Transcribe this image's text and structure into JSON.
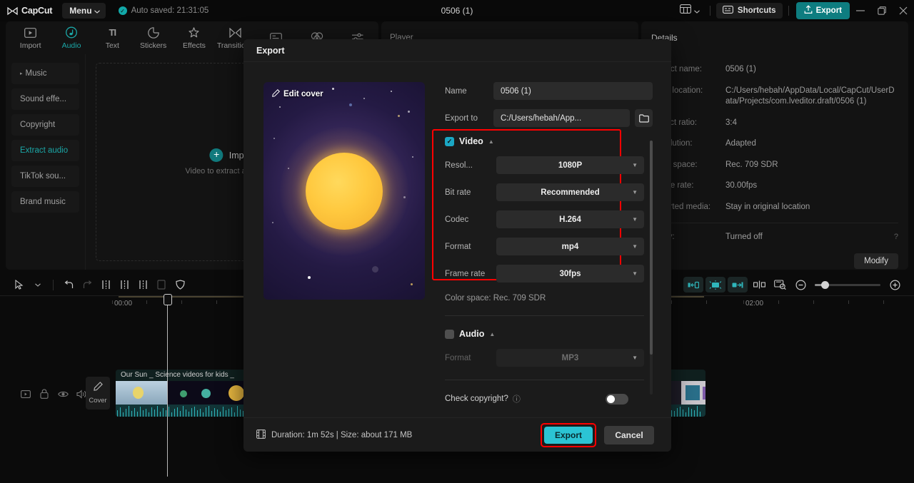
{
  "titlebar": {
    "app_name": "CapCut",
    "menu_label": "Menu",
    "autosave_text": "Auto saved: 21:31:05",
    "project_title": "0506 (1)",
    "shortcuts_label": "Shortcuts",
    "export_label": "Export",
    "minimize_icon": "minimize-icon",
    "maximize_icon": "maximize-icon",
    "close_icon": "close-icon",
    "layout_icon": "layout-icon"
  },
  "tooltabs": [
    {
      "label": "Import",
      "icon": "import-icon",
      "active": false
    },
    {
      "label": "Audio",
      "icon": "audio-note-icon",
      "active": true
    },
    {
      "label": "Text",
      "icon": "text-icon",
      "active": false
    },
    {
      "label": "Stickers",
      "icon": "sticker-icon",
      "active": false
    },
    {
      "label": "Effects",
      "icon": "effects-sparkle-icon",
      "active": false
    },
    {
      "label": "Transitions",
      "icon": "transitions-icon",
      "active": false
    },
    {
      "label": "",
      "icon": "captions-icon",
      "active": false
    },
    {
      "label": "",
      "icon": "filters-icon",
      "active": false
    },
    {
      "label": "",
      "icon": "adjustment-icon",
      "active": false
    }
  ],
  "media_sidebar": [
    {
      "label": "Music",
      "caret": "▸",
      "active": false
    },
    {
      "label": "Sound effe...",
      "caret": "",
      "active": false
    },
    {
      "label": "Copyright",
      "caret": "",
      "active": false
    },
    {
      "label": "Extract audio",
      "caret": "",
      "active": true
    },
    {
      "label": "TikTok sou...",
      "caret": "",
      "active": false
    },
    {
      "label": "Brand music",
      "caret": "",
      "active": false
    }
  ],
  "media_body": {
    "import_label": "Import",
    "import_sub": "Video to extract audio from",
    "plus_icon": "plus-circle-icon"
  },
  "panels": {
    "player_title": "Player",
    "details_title": "Details"
  },
  "details": [
    {
      "key": "Project name:",
      "value": "0506 (1)"
    },
    {
      "key": "Save location:",
      "value": "C:/Users/hebah/AppData/Local/CapCut/UserData/Projects/com.lveditor.draft/0506 (1)"
    },
    {
      "key": "Aspect ratio:",
      "value": "3:4"
    },
    {
      "key": "Resolution:",
      "value": "Adapted"
    },
    {
      "key": "Color space:",
      "value": "Rec. 709 SDR"
    },
    {
      "key": "Frame rate:",
      "value": "30.00fps"
    },
    {
      "key": "Imported media:",
      "value": "Stay in original location"
    }
  ],
  "details_footer": {
    "key": "Proxy:",
    "value": "Turned off",
    "help_icon": "question-icon",
    "modify_label": "Modify"
  },
  "timeline_toolbar": {
    "left_icons": [
      "select-cursor-icon",
      "chevron-down-icon",
      "undo-icon",
      "redo-icon",
      "split-icon",
      "trim-left-icon",
      "trim-right-icon",
      "delete-icon",
      "mask-icon"
    ],
    "right_icons": [
      "snap-left-icon",
      "auto-split-icon",
      "snap-right-icon",
      "keyframe-icon",
      "preview-scale-icon",
      "zoom-out-icon",
      "zoom-in-icon"
    ]
  },
  "ruler": {
    "labels": [
      "00:00",
      "02:00"
    ],
    "playhead_position": "00:00"
  },
  "track": {
    "control_icons": [
      "frame-icon",
      "lock-icon",
      "eye-icon",
      "volume-icon"
    ],
    "cover_label": "Cover",
    "cover_icon": "pencil-icon",
    "clip_title": "Our Sun _ Science videos for kids _"
  },
  "dialog": {
    "title": "Export",
    "cover": {
      "edit_label": "Edit cover",
      "pencil_icon": "pencil-icon"
    },
    "fields": [
      {
        "label": "Name",
        "value": "0506 (1)"
      },
      {
        "label": "Export to",
        "value": "C:/Users/hebah/App...",
        "has_folder_button": true,
        "folder_icon": "folder-icon"
      }
    ],
    "video_section": {
      "title": "Video",
      "checked": true,
      "check_glyph": "✓",
      "collapse_icon": "caret-up-icon",
      "highlighted": true,
      "highlight_color": "#ff0000",
      "rows": [
        {
          "label": "Resol...",
          "value": "1080P"
        },
        {
          "label": "Bit rate",
          "value": "Recommended"
        },
        {
          "label": "Codec",
          "value": "H.264"
        },
        {
          "label": "Format",
          "value": "mp4"
        },
        {
          "label": "Frame rate",
          "value": "30fps"
        }
      ]
    },
    "color_space_note": "Color space: Rec. 709 SDR",
    "audio_section": {
      "title": "Audio",
      "checked": false,
      "collapse_icon": "caret-up-icon",
      "rows": [
        {
          "label": "Format",
          "value": "MP3"
        }
      ]
    },
    "copyright": {
      "label": "Check copyright?",
      "help_icon": "question-icon",
      "toggle_on": false
    },
    "footer": {
      "summary": "Duration: 1m 52s | Size: about 171 MB",
      "film_icon": "film-icon",
      "export_label": "Export",
      "cancel_label": "Cancel",
      "export_highlighted": true
    }
  },
  "colors": {
    "accent_teal": "#1ba7a7",
    "export_btn": "#2bc4d4",
    "export_top_btn": "#0e7d80",
    "highlight_red": "#ff0000",
    "checkbox_blue": "#1ba7c4",
    "dialog_bg": "#1b1b1b",
    "app_bg": "#0b0b0b"
  }
}
